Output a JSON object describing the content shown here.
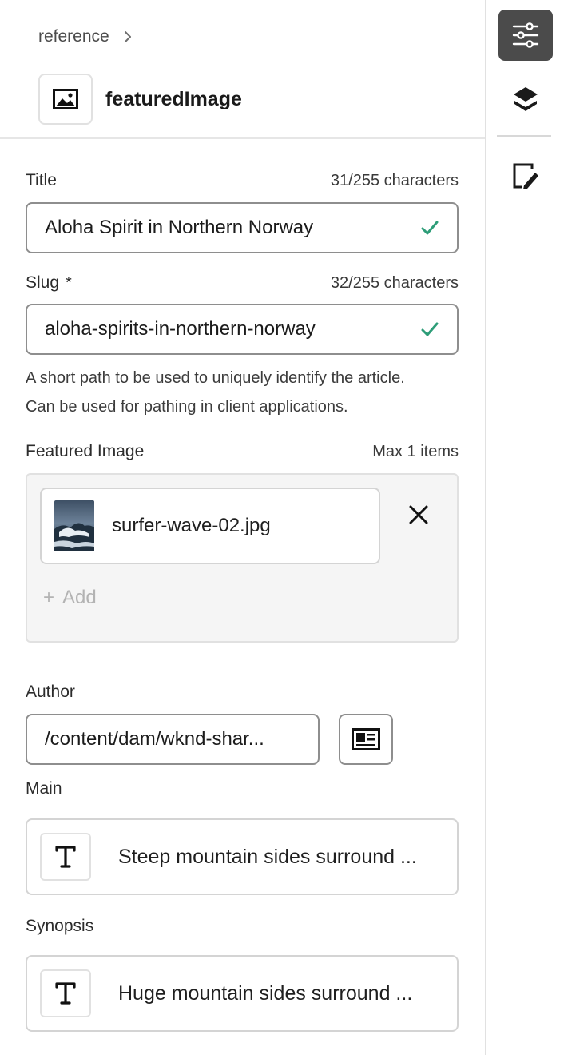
{
  "breadcrumb": {
    "label": "reference"
  },
  "header": {
    "title": "featuredImage",
    "type_icon": "image-icon"
  },
  "fields": {
    "title": {
      "label": "Title",
      "count": "31/255 characters",
      "value": "Aloha Spirit in Northern Norway"
    },
    "slug": {
      "label": "Slug",
      "required_mark": "*",
      "count": "32/255 characters",
      "value": "aloha-spirits-in-northern-norway",
      "help": [
        "A short path to be used to uniquely identify the article.",
        "Can be used for pathing in client applications."
      ]
    },
    "featured_image": {
      "label": "Featured Image",
      "max": "Max 1 items",
      "asset_name": "surfer-wave-02.jpg",
      "add_label": "Add",
      "add_symbol": "+"
    },
    "author": {
      "label": "Author",
      "value": "/content/dam/wknd-shar..."
    },
    "main": {
      "label": "Main",
      "preview": "Steep mountain sides surround ..."
    },
    "synopsis": {
      "label": "Synopsis",
      "preview": "Huge mountain sides surround ..."
    }
  },
  "rail": {
    "items": [
      {
        "icon": "properties-sliders-icon",
        "active": true
      },
      {
        "icon": "layers-icon",
        "active": false
      },
      {
        "icon": "edit-annotation-icon",
        "active": false
      }
    ]
  },
  "colors": {
    "valid_check": "#2d9d78",
    "rail_active": "#4b4b4b",
    "border": "#8e8e8e"
  }
}
